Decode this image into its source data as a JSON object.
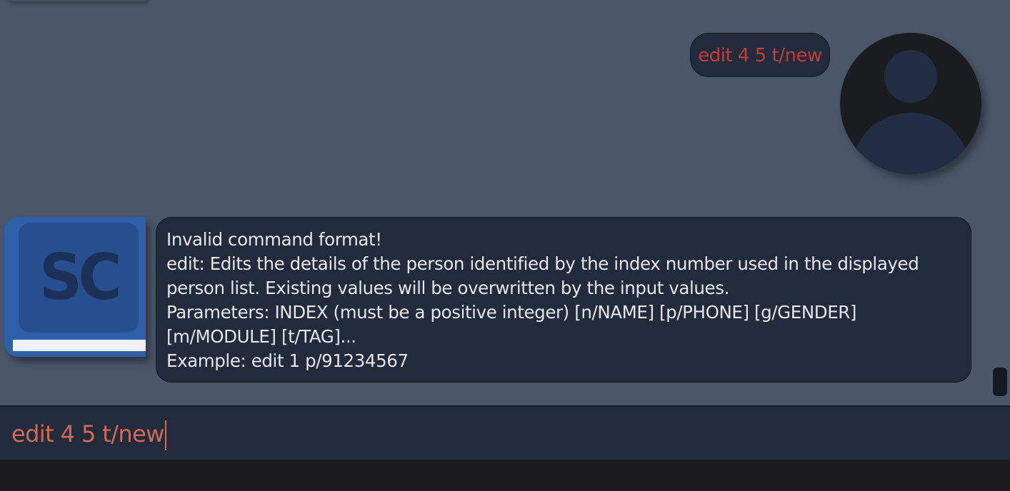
{
  "chat": {
    "user_message": "edit 4 5 t/new",
    "bot_avatar_logo": "SC",
    "bot_response": {
      "lines": [
        "Invalid command format!",
        "edit: Edits the details of the person identified by the index number used in the displayed",
        "person list. Existing values will be overwritten by the input values.",
        "Parameters: INDEX (must be a positive integer) [n/NAME] [p/PHONE] [g/GENDER]",
        "[m/MODULE] [t/TAG]...",
        "Example: edit 1 p/91234567"
      ]
    }
  },
  "command_box": {
    "value": "edit 4 5 t/new"
  },
  "colors": {
    "chat_background": "#4a5769",
    "bubble_background": "#222b3b",
    "user_message_text": "#c53a3a",
    "command_text": "#d26b55",
    "bot_avatar_blue": "#2f5fa8"
  },
  "icons": {
    "user_avatar": "user-silhouette-icon",
    "bot_avatar": "book-logo-icon"
  }
}
